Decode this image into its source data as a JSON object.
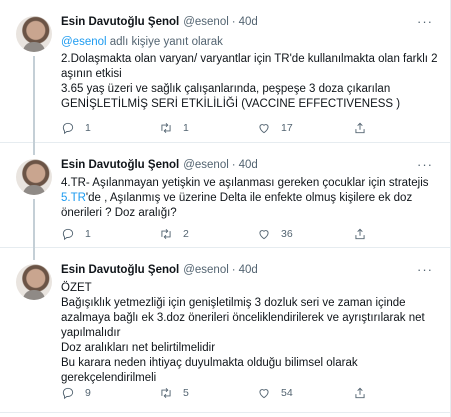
{
  "tweets": [
    {
      "author_name": "Esin Davutoğlu Şenol",
      "handle": "@esenol",
      "separator": "·",
      "time": "40d",
      "more_label": "···",
      "reply_mention": "@esenol",
      "reply_suffix": " adlı kişiye yanıt olarak",
      "lines": [
        "2.Dolaşmakta olan varyan/ varyantlar için TR'de kullanılmakta olan farklı 2 aşının etkisi",
        "3.65 yaş üzeri ve sağlık çalışanlarında, peşpeşe 3 doza çıkarılan GENİŞLETİLMİŞ SERİ ETKİLİLİĞİ (VACCINE EFFECTIVENESS )"
      ],
      "replies": "1",
      "retweets": "1",
      "likes": "17"
    },
    {
      "author_name": "Esin Davutoğlu Şenol",
      "handle": "@esenol",
      "separator": "·",
      "time": "40d",
      "more_label": "···",
      "line1": "4.TR- Aşılanmayan yetişkin ve aşılanması gereken çocuklar için stratejis",
      "line2_link": "5.TR",
      "line2_rest": "'de , Aşılanmış ve üzerine Delta ile enfekte olmuş kişilere ek doz önerileri ? Doz aralığı?",
      "replies": "1",
      "retweets": "2",
      "likes": "36"
    },
    {
      "author_name": "Esin Davutoğlu Şenol",
      "handle": "@esenol",
      "separator": "·",
      "time": "40d",
      "more_label": "···",
      "lines": [
        "ÖZET",
        "Bağışıklık yetmezliği  için genişletilmiş 3 dozluk seri ve zaman içinde azalmaya bağlı ek 3.doz önerileri  önceliklendirilerek ve ayrıştırılarak net yapılmalıdır",
        "Doz aralıkları net belirtilmelidir",
        "Bu karara neden ihtiyaç duyulmakta olduğu bilimsel olarak gerekçelendirilmeli"
      ],
      "replies": "9",
      "retweets": "5",
      "likes": "54"
    }
  ],
  "icons": {
    "reply": "reply-icon",
    "retweet": "retweet-icon",
    "like": "heart-icon",
    "share": "share-icon",
    "more": "more-icon"
  },
  "colors": {
    "link": "#1d9bf0",
    "secondary_text": "#536471",
    "thread_line": "#c4cfd6",
    "divider": "#e6ecf0"
  }
}
